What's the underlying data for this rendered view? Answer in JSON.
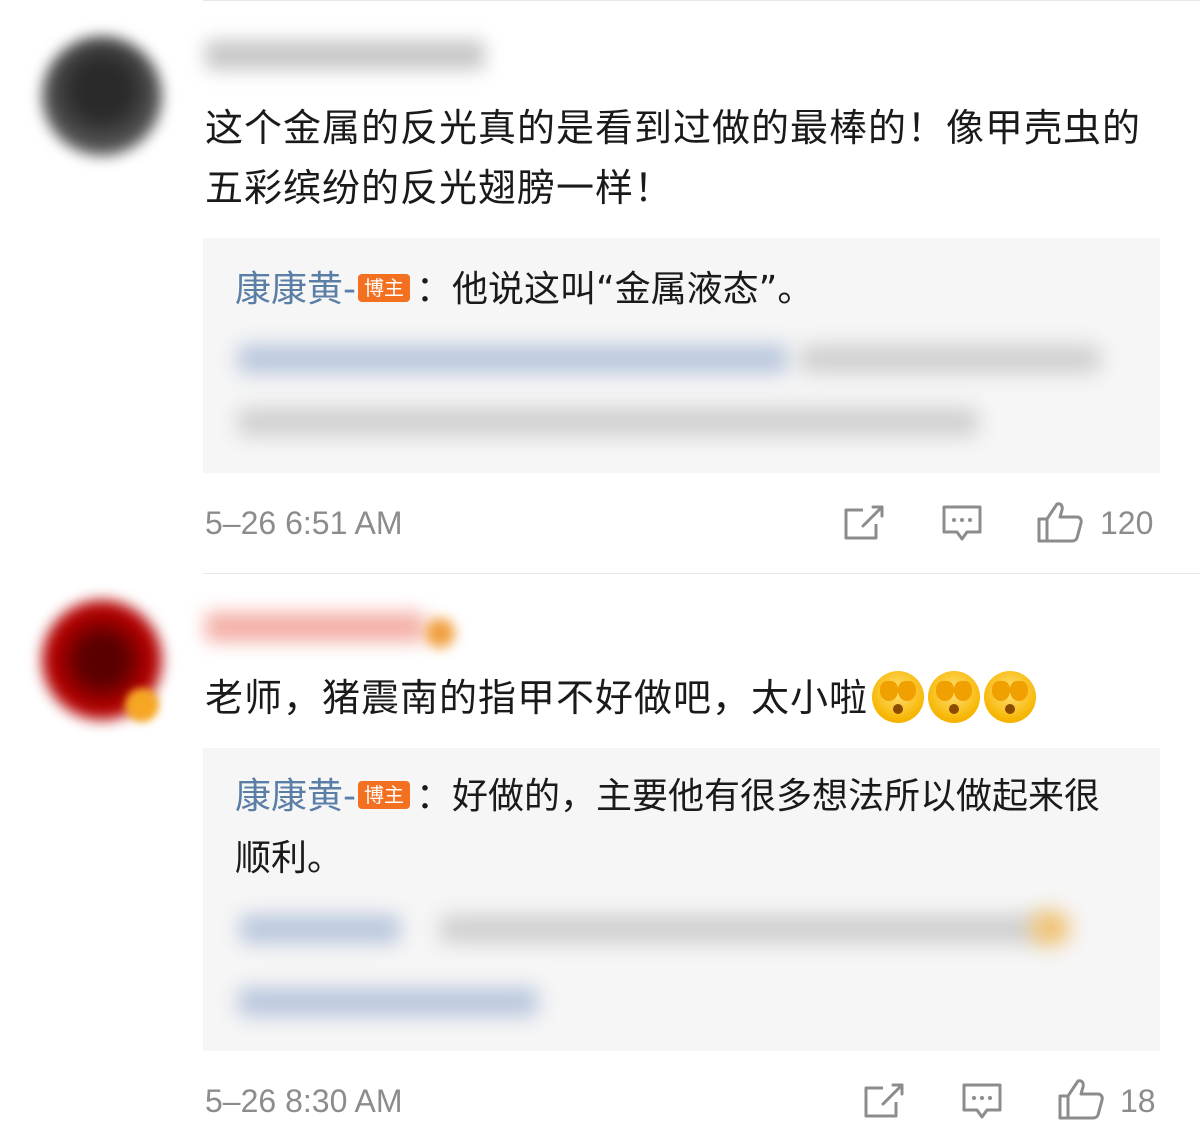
{
  "comments": [
    {
      "text": "这个金属的反光真的是看到过做的最棒的！像甲壳虫的五彩缤纷的反光翅膀一样！",
      "reply": {
        "author": "康康黄-",
        "badge": "博主",
        "separator": "：",
        "text": "他说这叫“金属液态”。"
      },
      "time": "5–26 6:51 AM",
      "likes": "120"
    },
    {
      "text": "老师，猪震南的指甲不好做吧，太小啦",
      "emoji_count": 3,
      "reply": {
        "author": "康康黄-",
        "badge": "博主",
        "separator": "：",
        "text": "好做的，主要他有很多想法所以做起来很顺利。"
      },
      "time": "5–26 8:30 AM",
      "likes": "18"
    }
  ],
  "icons": {
    "share": "share-icon",
    "comment": "comment-icon",
    "like": "thumbs-up-icon",
    "emoji": "face-covering-eyes-emoji"
  },
  "colors": {
    "replier_name": "#5b7ea6",
    "badge": "#f37021",
    "meta": "#8c8c8c",
    "reply_bg": "#f6f6f6"
  }
}
